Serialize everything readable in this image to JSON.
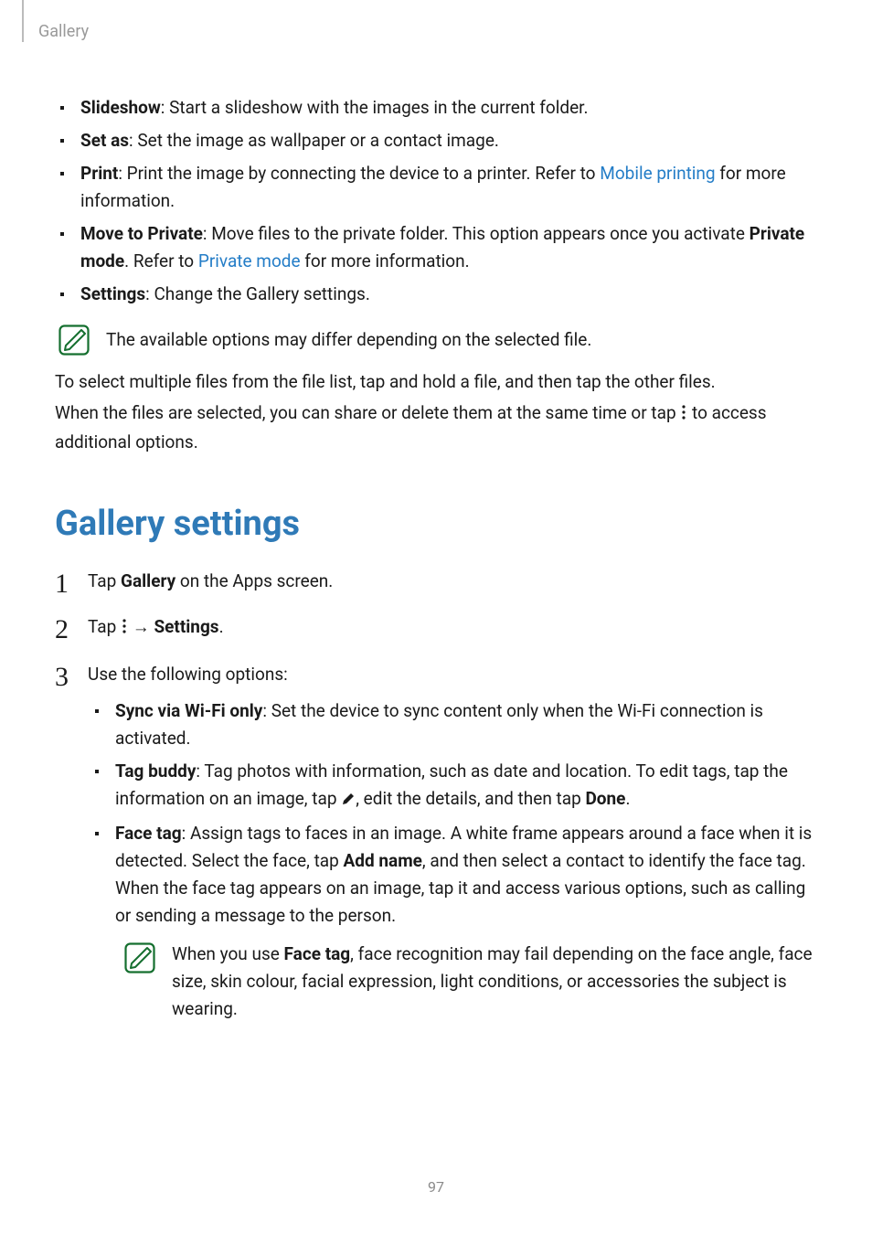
{
  "header": {
    "section": "Gallery"
  },
  "top_bullets": {
    "slideshow": {
      "label": "Slideshow",
      "desc": ": Start a slideshow with the images in the current folder."
    },
    "set_as": {
      "label": "Set as",
      "desc": ": Set the image as wallpaper or a contact image."
    },
    "print": {
      "label": "Print",
      "desc1": ": Print the image by connecting the device to a printer. Refer to ",
      "link": "Mobile printing",
      "desc2": " for more information."
    },
    "move_private": {
      "label": "Move to Private",
      "desc1": ": Move files to the private folder. This option appears once you activate ",
      "bold2": "Private mode",
      "desc2": ". Refer to ",
      "link": "Private mode",
      "desc3": " for more information."
    },
    "settings": {
      "label": "Settings",
      "desc": ": Change the Gallery settings."
    }
  },
  "note1": "The available options may differ depending on the selected file.",
  "multi_select": {
    "p1": "To select multiple files from the file list, tap and hold a file, and then tap the other files.",
    "p2a": "When the files are selected, you can share or delete them at the same time or tap ",
    "p2b": " to access additional options."
  },
  "h2": "Gallery settings",
  "steps": {
    "s1a": "Tap ",
    "s1b": "Gallery",
    "s1c": " on the Apps screen.",
    "s2a": "Tap ",
    "s2arrow": " → ",
    "s2b": "Settings",
    "s2c": ".",
    "s3": "Use the following options:"
  },
  "options": {
    "sync": {
      "label": "Sync via Wi-Fi only",
      "desc": ": Set the device to sync content only when the Wi-Fi connection is activated."
    },
    "tag_buddy": {
      "label": "Tag buddy",
      "desc1": ": Tag photos with information, such as date and location. To edit tags, tap the information on an image, tap ",
      "desc2": ", edit the details, and then tap ",
      "done": "Done",
      "desc3": "."
    },
    "face_tag": {
      "label": "Face tag",
      "desc1": ": Assign tags to faces in an image. A white frame appears around a face when it is detected. Select the face, tap ",
      "addname": "Add name",
      "desc2": ", and then select a contact to identify the face tag. When the face tag appears on an image, tap it and access various options, such as calling or sending a message to the person."
    }
  },
  "note2": {
    "t1": "When you use ",
    "bold": "Face tag",
    "t2": ", face recognition may fail depending on the face angle, face size, skin colour, facial expression, light conditions, or accessories the subject is wearing."
  },
  "page_number": "97"
}
